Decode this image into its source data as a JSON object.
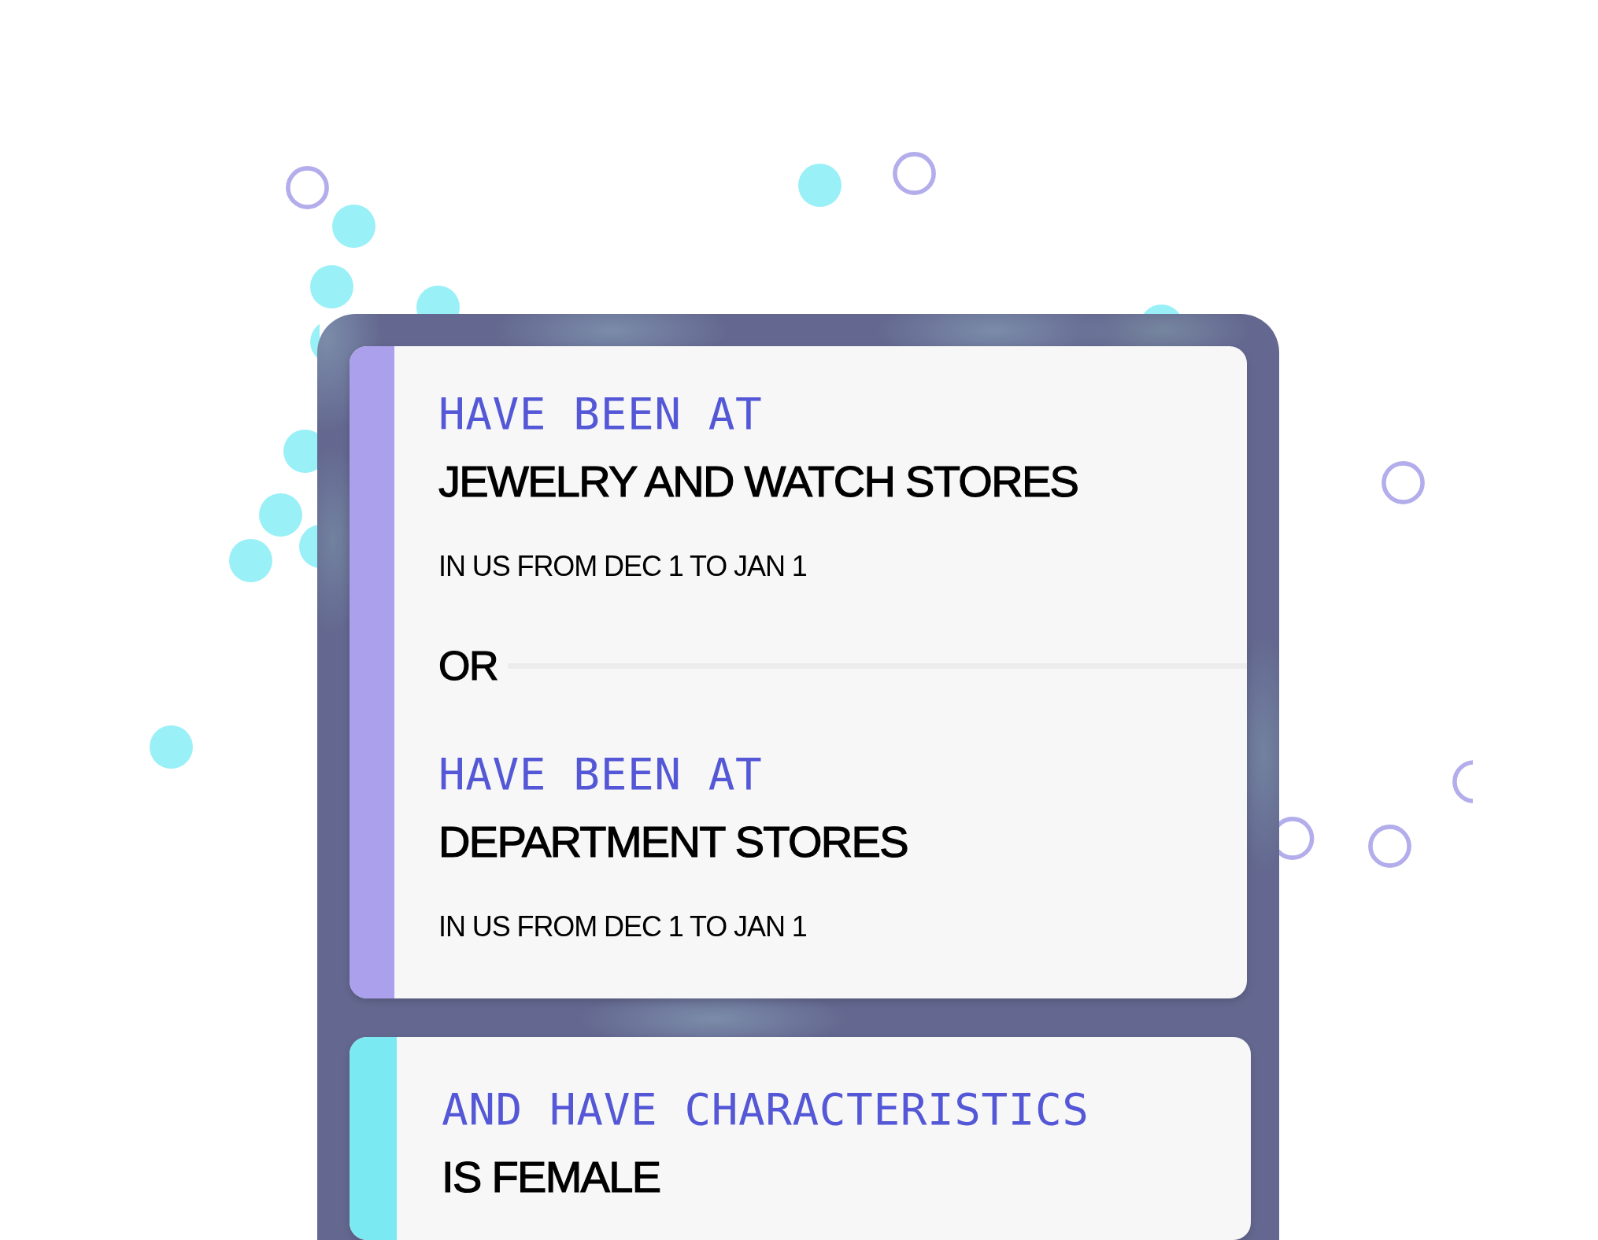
{
  "groups": [
    {
      "color": "#aaa0ec",
      "items": [
        {
          "kind": "condition",
          "label": "HAVE BEEN AT",
          "value": "JEWELRY AND WATCH STORES",
          "detail": "IN US FROM DEC 1 TO JAN 1"
        },
        {
          "kind": "operator",
          "text": "OR"
        },
        {
          "kind": "condition",
          "label": "HAVE BEEN AT",
          "value": "DEPARTMENT STORES",
          "detail": "IN US FROM DEC 1 TO JAN 1"
        }
      ]
    },
    {
      "color": "#7ae9f2",
      "items": [
        {
          "kind": "condition",
          "label": "AND HAVE CHARACTERISTICS",
          "value": "IS FEMALE"
        }
      ]
    }
  ]
}
